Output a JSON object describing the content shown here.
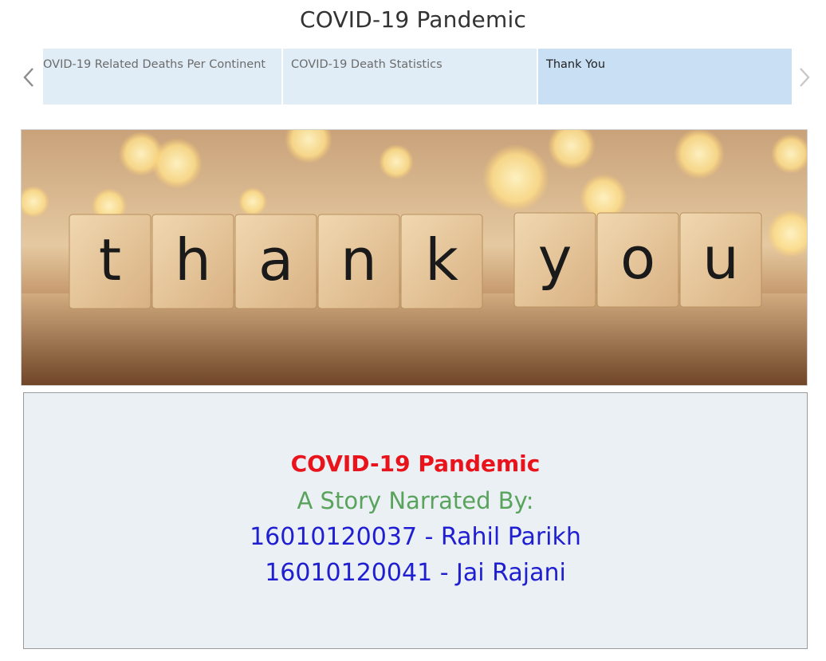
{
  "story": {
    "title": "COVID-19 Pandemic"
  },
  "navigation": {
    "prev_icon": "chevron-left-icon",
    "next_icon": "chevron-right-icon"
  },
  "tabs": [
    {
      "label": "OVID-19 Related Deaths Per Continent",
      "selected": false
    },
    {
      "label": "COVID-19 Death Statistics",
      "selected": false
    },
    {
      "label": "Thank You",
      "selected": true
    }
  ],
  "banner": {
    "tiles": [
      "t",
      "h",
      "a",
      "n",
      "k",
      "y",
      "o",
      "u"
    ]
  },
  "credits": {
    "heading": "COVID-19 Pandemic",
    "subheading": "A Story Narrated By:",
    "author_1": "16010120037 - Rahil Parikh",
    "author_2": "16010120041 - Jai Rajani"
  },
  "colors": {
    "heading": "#e8131b",
    "subheading": "#59a35d",
    "authors": "#1f1fd1",
    "tab": "#e1edf6",
    "tab_selected": "#c8dff4"
  }
}
